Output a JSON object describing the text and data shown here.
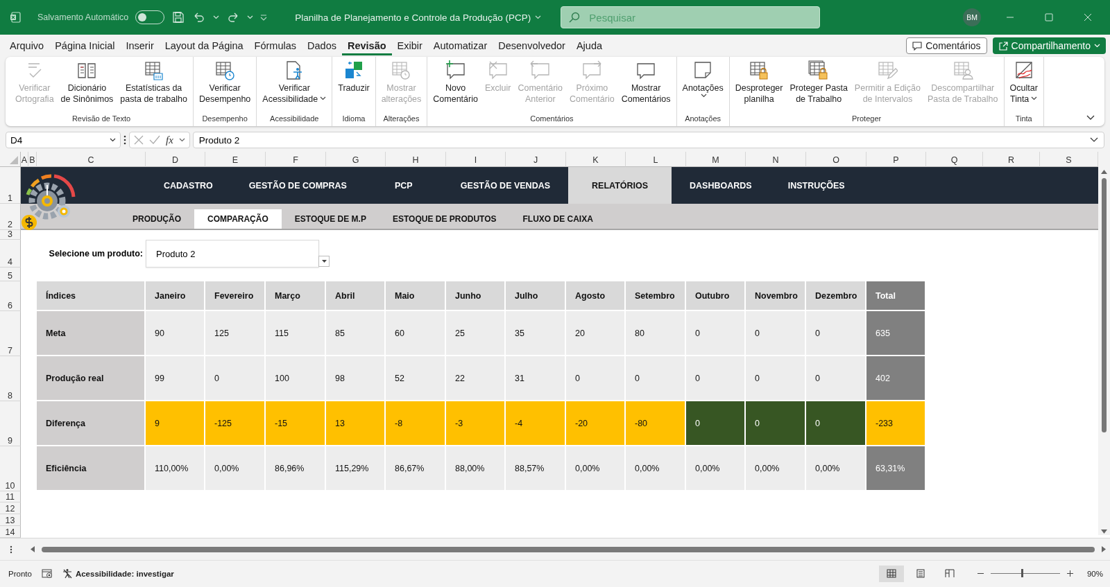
{
  "title_bar": {
    "autosave_label": "Salvamento Automático",
    "autosave_on": false,
    "document_title": "Planilha de Planejamento e Controle da Produção (PCP)",
    "search_placeholder": "Pesquisar",
    "user_initials": "BM"
  },
  "menu_tabs": [
    {
      "label": "Arquivo",
      "selected": false
    },
    {
      "label": "Página Inicial",
      "selected": false
    },
    {
      "label": "Inserir",
      "selected": false
    },
    {
      "label": "Layout da Página",
      "selected": false
    },
    {
      "label": "Fórmulas",
      "selected": false
    },
    {
      "label": "Dados",
      "selected": false
    },
    {
      "label": "Revisão",
      "selected": true
    },
    {
      "label": "Exibir",
      "selected": false
    },
    {
      "label": "Automatizar",
      "selected": false
    },
    {
      "label": "Desenvolvedor",
      "selected": false
    },
    {
      "label": "Ajuda",
      "selected": false
    }
  ],
  "header_buttons": {
    "comments": "Comentários",
    "share": "Compartilhamento"
  },
  "ribbon_groups": [
    {
      "label": "Revisão de Texto",
      "items": [
        {
          "lines": [
            "Verificar",
            "Ortografia"
          ],
          "disabled": true,
          "dropdown": false
        },
        {
          "lines": [
            "Dicionário",
            "de Sinônimos"
          ],
          "disabled": false,
          "dropdown": false
        },
        {
          "lines": [
            "Estatísticas da",
            "pasta de trabalho"
          ],
          "disabled": false,
          "dropdown": false
        }
      ]
    },
    {
      "label": "Desempenho",
      "items": [
        {
          "lines": [
            "Verificar",
            "Desempenho"
          ],
          "disabled": false,
          "dropdown": false
        }
      ]
    },
    {
      "label": "Acessibilidade",
      "items": [
        {
          "lines": [
            "Verificar",
            "Acessibilidade"
          ],
          "disabled": false,
          "dropdown": true
        }
      ]
    },
    {
      "label": "Idioma",
      "items": [
        {
          "lines": [
            "Traduzir"
          ],
          "disabled": false,
          "dropdown": false
        }
      ]
    },
    {
      "label": "Alterações",
      "items": [
        {
          "lines": [
            "Mostrar",
            "alterações"
          ],
          "disabled": true,
          "dropdown": false
        }
      ]
    },
    {
      "label": "Comentários",
      "items": [
        {
          "lines": [
            "Novo",
            "Comentário"
          ],
          "disabled": false,
          "dropdown": false
        },
        {
          "lines": [
            "Excluir"
          ],
          "disabled": true,
          "dropdown": false
        },
        {
          "lines": [
            "Comentário",
            "Anterior"
          ],
          "disabled": true,
          "dropdown": false
        },
        {
          "lines": [
            "Próximo",
            "Comentário"
          ],
          "disabled": true,
          "dropdown": false
        },
        {
          "lines": [
            "Mostrar",
            "Comentários"
          ],
          "disabled": false,
          "dropdown": false
        }
      ]
    },
    {
      "label": "Anotações",
      "items": [
        {
          "lines": [
            "Anotações"
          ],
          "disabled": false,
          "dropdown": true
        }
      ]
    },
    {
      "label": "Proteger",
      "items": [
        {
          "lines": [
            "Desproteger",
            "planilha"
          ],
          "disabled": false,
          "dropdown": false
        },
        {
          "lines": [
            "Proteger Pasta",
            "de Trabalho"
          ],
          "disabled": false,
          "dropdown": false
        },
        {
          "lines": [
            "Permitir a Edição",
            "de Intervalos"
          ],
          "disabled": true,
          "dropdown": false
        },
        {
          "lines": [
            "Descompartilhar",
            "Pasta de Trabalho"
          ],
          "disabled": true,
          "dropdown": false
        }
      ]
    },
    {
      "label": "Tinta",
      "items": [
        {
          "lines": [
            "Ocultar",
            "Tinta"
          ],
          "disabled": false,
          "dropdown": true
        }
      ]
    }
  ],
  "formula_bar": {
    "name_box": "D4",
    "function_label": "fx",
    "formula": "Produto 2"
  },
  "columns": [
    "A",
    "B",
    "C",
    "D",
    "E",
    "F",
    "G",
    "H",
    "I",
    "J",
    "K",
    "L",
    "M",
    "N",
    "O",
    "P",
    "Q",
    "R",
    "S"
  ],
  "row_numbers": [
    "1",
    "2",
    "3",
    "4",
    "5",
    "6",
    "7",
    "8",
    "9",
    "10",
    "11",
    "12",
    "13",
    "14"
  ],
  "nav_tabs": [
    {
      "label": "CADASTRO",
      "selected": false
    },
    {
      "label": "GESTÃO DE COMPRAS",
      "selected": false
    },
    {
      "label": "PCP",
      "selected": false
    },
    {
      "label": "GESTÃO DE VENDAS",
      "selected": false
    },
    {
      "label": "RELATÓRIOS",
      "selected": true
    },
    {
      "label": "DASHBOARDS",
      "selected": false
    },
    {
      "label": "INSTRUÇÕES",
      "selected": false
    }
  ],
  "sub_tabs": [
    {
      "label": "PRODUÇÃO",
      "selected": false
    },
    {
      "label": "COMPARAÇÃO",
      "selected": true
    },
    {
      "label": "ESTOQUE DE M.P",
      "selected": false
    },
    {
      "label": "ESTOQUE DE PRODUTOS",
      "selected": false
    },
    {
      "label": "FLUXO DE CAIXA",
      "selected": false
    }
  ],
  "product_selector": {
    "label": "Selecione um produto:",
    "value": "Produto 2"
  },
  "table": {
    "columns": [
      "Índices",
      "Janeiro",
      "Fevereiro",
      "Março",
      "Abril",
      "Maio",
      "Junho",
      "Julho",
      "Agosto",
      "Setembro",
      "Outubro",
      "Novembro",
      "Dezembro",
      "Total"
    ],
    "rows": [
      {
        "cells": [
          {
            "value": "Meta"
          },
          {
            "value": "90"
          },
          {
            "value": "125"
          },
          {
            "value": "115"
          },
          {
            "value": "85"
          },
          {
            "value": "60"
          },
          {
            "value": "25"
          },
          {
            "value": "35"
          },
          {
            "value": "20"
          },
          {
            "value": "80"
          },
          {
            "value": "0"
          },
          {
            "value": "0"
          },
          {
            "value": "0"
          },
          {
            "value": "635",
            "color": "#808080"
          }
        ]
      },
      {
        "cells": [
          {
            "value": "Produção real"
          },
          {
            "value": "99"
          },
          {
            "value": "0"
          },
          {
            "value": "100"
          },
          {
            "value": "98"
          },
          {
            "value": "52"
          },
          {
            "value": "22"
          },
          {
            "value": "31"
          },
          {
            "value": "0"
          },
          {
            "value": "0"
          },
          {
            "value": "0"
          },
          {
            "value": "0"
          },
          {
            "value": "0"
          },
          {
            "value": "402",
            "color": "#808080"
          }
        ]
      },
      {
        "cells": [
          {
            "value": "Diferença"
          },
          {
            "value": "9",
            "color": "#ffc000"
          },
          {
            "value": "-125",
            "color": "#ffc000"
          },
          {
            "value": "-15",
            "color": "#ffc000"
          },
          {
            "value": "13",
            "color": "#ffc000"
          },
          {
            "value": "-8",
            "color": "#ffc000"
          },
          {
            "value": "-3",
            "color": "#ffc000"
          },
          {
            "value": "-4",
            "color": "#ffc000"
          },
          {
            "value": "-20",
            "color": "#ffc000"
          },
          {
            "value": "-80",
            "color": "#ffc000"
          },
          {
            "value": "0",
            "color": "#375623"
          },
          {
            "value": "0",
            "color": "#375623"
          },
          {
            "value": "0",
            "color": "#375623"
          },
          {
            "value": "-233",
            "color": "#ffc000"
          }
        ]
      },
      {
        "cells": [
          {
            "value": "Eficiência"
          },
          {
            "value": "110,00%"
          },
          {
            "value": "0,00%"
          },
          {
            "value": "86,96%"
          },
          {
            "value": "115,29%"
          },
          {
            "value": "86,67%"
          },
          {
            "value": "88,00%"
          },
          {
            "value": "88,57%"
          },
          {
            "value": "0,00%"
          },
          {
            "value": "0,00%"
          },
          {
            "value": "0,00%"
          },
          {
            "value": "0,00%"
          },
          {
            "value": "0,00%"
          },
          {
            "value": "63,31%",
            "color": "#808080"
          }
        ]
      }
    ]
  },
  "status_bar": {
    "ready": "Pronto",
    "accessibility": "Acessibilidade: investigar",
    "views": [
      {
        "selected": true
      },
      {
        "selected": false
      },
      {
        "selected": false
      }
    ],
    "zoom_slider": {
      "level": 0.46
    },
    "zoom": "90%"
  }
}
